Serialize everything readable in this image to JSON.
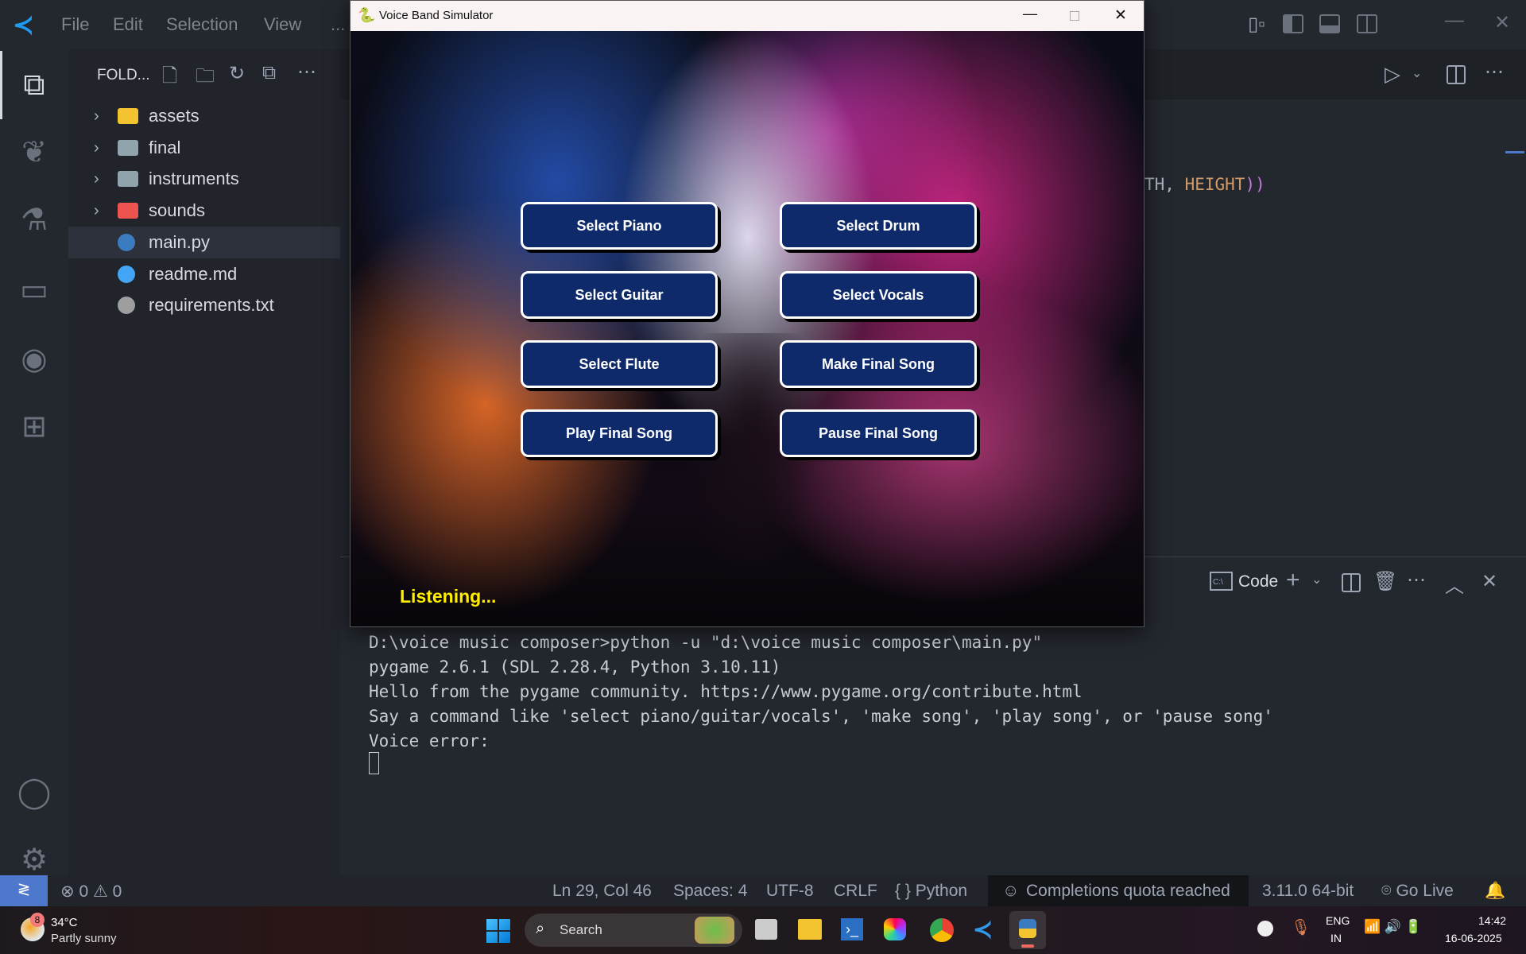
{
  "menu": [
    "File",
    "Edit",
    "Selection",
    "View",
    "..."
  ],
  "explorer": {
    "title": "FOLD...",
    "items": [
      {
        "label": "assets",
        "type": "folder",
        "color": "#f4c430"
      },
      {
        "label": "final",
        "type": "folder",
        "color": "#90a4ae"
      },
      {
        "label": "instruments",
        "type": "folder",
        "color": "#90a4ae"
      },
      {
        "label": "sounds",
        "type": "folder",
        "color": "#ef5350"
      },
      {
        "label": "main.py",
        "type": "file",
        "color": "#3b7bbf",
        "selected": true
      },
      {
        "label": "readme.md",
        "type": "file",
        "color": "#42a5f5"
      },
      {
        "label": "requirements.txt",
        "type": "file",
        "color": "#9e9e9e"
      }
    ]
  },
  "editor": {
    "code_fragment_a": "TH, ",
    "code_fragment_b": "HEIGHT",
    "code_fragment_c": "))"
  },
  "pygame": {
    "title": "Voice Band Simulator",
    "buttons": [
      "Select Piano",
      "Select Drum",
      "Select Guitar",
      "Select Vocals",
      "Select Flute",
      "Make Final Song",
      "Play Final Song",
      "Pause Final Song"
    ],
    "status": "Listening...",
    "status_color": "#ffee00",
    "button_color": "#0e2a6a"
  },
  "panel": {
    "terminal_name": "Code",
    "terminal_icon": "C:\\",
    "lines": [
      "D:\\voice music composer>python -u \"d:\\voice music composer\\main.py\"",
      "pygame 2.6.1 (SDL 2.28.4, Python 3.10.11)",
      "Hello from the pygame community. https://www.pygame.org/contribute.html",
      "Say a command like 'select piano/guitar/vocals', 'make song', 'play song', or 'pause song'",
      "Voice error:"
    ]
  },
  "status": {
    "errors": "0",
    "warnings": "0",
    "position": "Ln 29, Col 46",
    "spaces": "Spaces: 4",
    "encoding": "UTF-8",
    "eol": "CRLF",
    "language": "Python",
    "copilot": "Completions quota reached",
    "interpreter": "3.11.0 64-bit",
    "golive": "Go Live"
  },
  "taskbar": {
    "weather_temp": "34°C",
    "weather_desc": "Partly sunny",
    "weather_badge": "8",
    "search": "Search",
    "lang": "ENG",
    "region": "IN",
    "time": "14:42",
    "date": "16-06-2025"
  }
}
